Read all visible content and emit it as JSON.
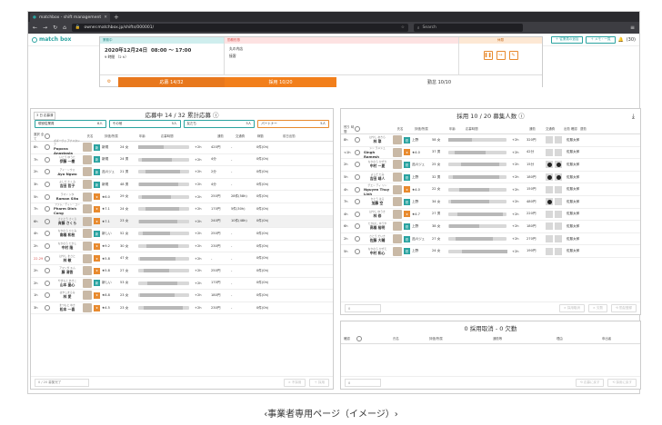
{
  "browser": {
    "tab_title": "matchbox - shift management",
    "url": "owner.matchbox.jp/shifts/000001/",
    "search_placeholder": "Search"
  },
  "app": {
    "logo": "match box",
    "header_btn1": "＋ 従業員の追加",
    "header_btn2": "＋ メモ・一覧",
    "notif_count": "(30)"
  },
  "shift": {
    "tag1": "業務中",
    "tag2": "勤務形態",
    "tag3": "休憩",
    "date": "2020年12月24日",
    "time": "08:00 ～ 17:00",
    "duration": "9 時間 （2 h）",
    "place": "丸の内店",
    "role": "接客",
    "applied": "応募 14/32",
    "hired": "採用 10/20",
    "working": "勤怠 10/10"
  },
  "left": {
    "pill": "3 日 応募済",
    "title": "応募中 14 / 32 累計応募",
    "filters": [
      {
        "label": "現役従業員",
        "n": "8人"
      },
      {
        "label": "その他",
        "n": "5人"
      },
      {
        "label": "友だち",
        "n": "5人"
      },
      {
        "label": "パートナー",
        "n": "5人"
      }
    ],
    "headers": [
      "選択 全て",
      "氏名",
      "評価/所属",
      "年齢",
      "応募時間",
      "通勤",
      "交通費",
      "稼動",
      "前日出勤"
    ],
    "rows": [
      {
        "t": "8h",
        "k": "ポポーヴァ アナスタシア",
        "j": "Popova Anastasia",
        "b": "新規",
        "bc": "#2aa3a0",
        "age": "24",
        "g": "女",
        "w": "+2h",
        "c": "420円",
        "x": "-",
        "d": "0件(0h)"
      },
      {
        "t": "7h",
        "k": "いとう ゆうた",
        "j": "伊藤 一樹",
        "b": "新規",
        "bc": "#2aa3a0",
        "age": "24",
        "g": "男",
        "w": "+2h",
        "c": "4分",
        "x": "-",
        "d": "0件(0h)"
      },
      {
        "t": "2h",
        "k": "アイ・ンウォ",
        "j": "Ayo Ngwo",
        "b": "品川ジュ",
        "bc": "#2aa3a0",
        "age": "21",
        "g": "男",
        "w": "+2h",
        "c": "2分",
        "x": "-",
        "d": "0件(0h)"
      },
      {
        "t": "3h",
        "k": "よしだ たくみ",
        "j": "吉田 哲子",
        "b": "新規",
        "bc": "#2aa3a0",
        "age": "48",
        "g": "男",
        "w": "+2h",
        "c": "4分",
        "x": "-",
        "d": "0件(0h)"
      },
      {
        "t": "5h",
        "k": "ラマン シタ",
        "j": "Raman Sita",
        "b": "★6.0",
        "bc": "#e88a2e",
        "age": "29",
        "g": "女",
        "w": "+2h",
        "c": "250円",
        "x": "28件(58h)",
        "d": "0件(0h)"
      },
      {
        "t": "7h",
        "k": "ファム・ディン・コン",
        "j": "Pharm Dinh Cong",
        "b": "★7.1",
        "bc": "#e88a2e",
        "age": "24",
        "g": "女",
        "w": "+2h",
        "c": "170円",
        "x": "5件(30h)",
        "d": "0件(0h)"
      },
      {
        "t": "6h",
        "k": "さいとう さくら",
        "j": "斉藤 さくら",
        "b": "★7.1",
        "bc": "#e88a2e",
        "age": "23",
        "g": "女",
        "w": "+2h",
        "c": "240円",
        "x": "10件(48h)",
        "d": "0件(0h)"
      },
      {
        "t": "4h",
        "k": "なかむら ひとみ",
        "j": "南橋 和枝",
        "b": "新しい",
        "bc": "#2aa3a0",
        "age": "52",
        "g": "女",
        "w": "+2h",
        "c": "250円",
        "x": "-",
        "d": "0件(0h)"
      },
      {
        "t": "2h",
        "k": "なかむら たかし",
        "j": "中村 隆",
        "b": "★9.2",
        "bc": "#e88a2e",
        "age": "30",
        "g": "女",
        "w": "+2h",
        "c": "230円",
        "x": "-",
        "d": "0件(0h)"
      },
      {
        "t": "22.29",
        "k": "はやし まさと",
        "j": "林 敏",
        "b": "★5.8",
        "bc": "#e88a2e",
        "age": "47",
        "g": "女",
        "w": "+2h",
        "c": "-",
        "x": "-",
        "d": "0件(0h)"
      },
      {
        "t": "2h",
        "k": "アマンダ キム",
        "j": "藤 清香",
        "b": "★5.8",
        "bc": "#e88a2e",
        "age": "27",
        "g": "女",
        "w": "+2h",
        "c": "250円",
        "x": "-",
        "d": "0件(0h)"
      },
      {
        "t": "2h",
        "k": "やまもと あきこ",
        "j": "山本 晶心",
        "b": "新しい",
        "bc": "#2aa3a0",
        "age": "53",
        "g": "女",
        "w": "+2h",
        "c": "170円",
        "x": "-",
        "d": "0件(0h)"
      },
      {
        "t": "1h",
        "k": "はやしまるみ",
        "j": "林 愛",
        "b": "★8.8",
        "bc": "#e88a2e",
        "age": "23",
        "g": "女",
        "w": "+2h",
        "c": "180円",
        "x": "-",
        "d": "0件(0h)"
      },
      {
        "t": "3h",
        "k": "まつもと ゆき",
        "j": "松本 一喜",
        "b": "★4.5",
        "bc": "#e88a2e",
        "age": "23",
        "g": "女",
        "w": "+2h",
        "c": "230円",
        "x": "-",
        "d": "0件(0h)"
      }
    ],
    "counter": "0 / 20 募集完了",
    "btn_hire": "＋ 採用",
    "btn_decline": "× 不採用"
  },
  "right": {
    "title": "採用 10 / 20 募集人数",
    "headers": [
      "残り 時間",
      "氏名",
      "評価/所属",
      "年齢",
      "応募時間",
      "通勤",
      "交通費",
      "出勤 確認",
      "退勤"
    ],
    "rows": [
      {
        "t": "8h",
        "k": "はやし あきら",
        "j": "林 翠",
        "b": "上野",
        "age": "58",
        "g": "女",
        "w": "+2h",
        "c": "320円",
        "t1": false,
        "t2": false,
        "s": "佐藤太郎"
      },
      {
        "t": "<1h",
        "k": "シン ラメシュ",
        "j": "Singh Ramesh",
        "b": "★4.0",
        "age": "37",
        "g": "男",
        "w": "+2h",
        "c": "42分",
        "t1": false,
        "t2": false,
        "s": "佐藤太郎"
      },
      {
        "t": "2h",
        "k": "なかむら かずき",
        "j": "中村 一夏",
        "b": "品川ジュ",
        "age": "25",
        "g": "女",
        "w": "+2h",
        "c": "15分",
        "t1": true,
        "t2": true,
        "s": "佐藤太郎"
      },
      {
        "t": "5h",
        "k": "よしだ たみ",
        "j": "吉田 靖人",
        "b": "上野",
        "age": "32",
        "g": "男",
        "w": "+2h",
        "c": "180円",
        "t1": true,
        "t2": true,
        "s": "佐藤太郎"
      },
      {
        "t": "4h",
        "k": "グエン ティ リン",
        "j": "Nguyen Thuy Linh",
        "b": "★4.0",
        "age": "22",
        "g": "女",
        "w": "+2h",
        "c": "150円",
        "t1": false,
        "t2": false,
        "s": "佐藤太郎"
      },
      {
        "t": "7h",
        "k": "かとう はる",
        "j": "加藤 空",
        "b": "上野",
        "age": "34",
        "g": "女",
        "w": "+2h",
        "c": "480円",
        "t1": true,
        "t2": false,
        "s": "佐藤太郎"
      },
      {
        "t": "4h",
        "k": "はやし ゆうき",
        "j": "林 修",
        "b": "★4.7",
        "age": "27",
        "g": "男",
        "w": "+2h",
        "c": "220円",
        "t1": false,
        "t2": false,
        "s": "佐藤太郎"
      },
      {
        "t": "6h",
        "k": "たかはし ゆうや",
        "j": "高橋 裕明",
        "b": "上野",
        "age": "38",
        "g": "女",
        "w": "+2h",
        "c": "180円",
        "t1": false,
        "t2": false,
        "s": "佐藤太郎"
      },
      {
        "t": "2h",
        "k": "さとう だいき",
        "j": "佐藤 大輔",
        "b": "品川ジュ",
        "age": "27",
        "g": "女",
        "w": "+2h",
        "c": "270円",
        "t1": false,
        "t2": false,
        "s": "佐藤太郎"
      },
      {
        "t": "5h",
        "k": "なかむら かずえ",
        "j": "中村 和心",
        "b": "上野",
        "age": "24",
        "g": "女",
        "w": "+2h",
        "c": "190円",
        "t1": false,
        "t2": false,
        "s": "佐藤太郎"
      }
    ],
    "counter": "0",
    "btn1": "× 採用取消",
    "btn2": "× 欠勤",
    "btn3": "⟲ 勤怠登録"
  },
  "bottom": {
    "title": "0 採用取消 - 0 欠勤",
    "headers": [
      "確認",
      "氏名",
      "評価/所属",
      "通勤等",
      "理由",
      "申出者"
    ],
    "counter": "0",
    "btn1": "⟲ 応募に戻す",
    "btn2": "⟲ 採用に戻す"
  },
  "caption": "‹事業者専用ページ（イメージ）›"
}
